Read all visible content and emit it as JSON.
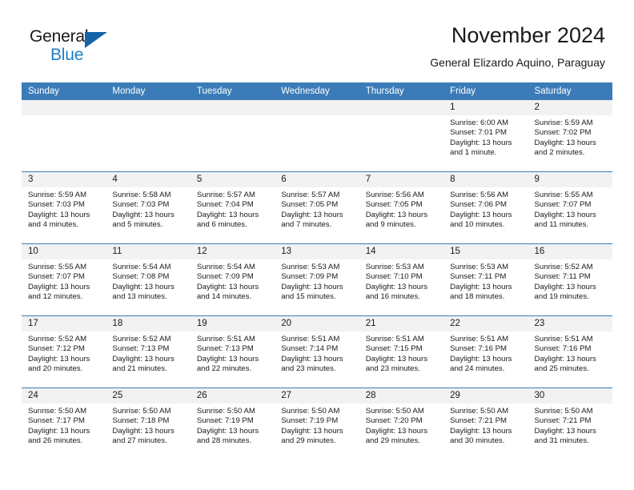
{
  "brand": {
    "word_general": "General",
    "word_blue": "Blue",
    "triangle_color": "#1565a8",
    "blue_color": "#1d80c8"
  },
  "header": {
    "title": "November 2024",
    "subtitle": "General Elizardo Aquino, Paraguay"
  },
  "theme": {
    "header_bar": "#3b7cb8",
    "day_band": "#f2f2f2",
    "text": "#1a1a1a"
  },
  "calendar": {
    "weekdays": [
      "Sunday",
      "Monday",
      "Tuesday",
      "Wednesday",
      "Thursday",
      "Friday",
      "Saturday"
    ],
    "weeks": [
      [
        {
          "day": "",
          "empty": true
        },
        {
          "day": "",
          "empty": true
        },
        {
          "day": "",
          "empty": true
        },
        {
          "day": "",
          "empty": true
        },
        {
          "day": "",
          "empty": true
        },
        {
          "day": "1",
          "sunrise": "Sunrise: 6:00 AM",
          "sunset": "Sunset: 7:01 PM",
          "daylight": "Daylight: 13 hours and 1 minute."
        },
        {
          "day": "2",
          "sunrise": "Sunrise: 5:59 AM",
          "sunset": "Sunset: 7:02 PM",
          "daylight": "Daylight: 13 hours and 2 minutes."
        }
      ],
      [
        {
          "day": "3",
          "sunrise": "Sunrise: 5:59 AM",
          "sunset": "Sunset: 7:03 PM",
          "daylight": "Daylight: 13 hours and 4 minutes."
        },
        {
          "day": "4",
          "sunrise": "Sunrise: 5:58 AM",
          "sunset": "Sunset: 7:03 PM",
          "daylight": "Daylight: 13 hours and 5 minutes."
        },
        {
          "day": "5",
          "sunrise": "Sunrise: 5:57 AM",
          "sunset": "Sunset: 7:04 PM",
          "daylight": "Daylight: 13 hours and 6 minutes."
        },
        {
          "day": "6",
          "sunrise": "Sunrise: 5:57 AM",
          "sunset": "Sunset: 7:05 PM",
          "daylight": "Daylight: 13 hours and 7 minutes."
        },
        {
          "day": "7",
          "sunrise": "Sunrise: 5:56 AM",
          "sunset": "Sunset: 7:05 PM",
          "daylight": "Daylight: 13 hours and 9 minutes."
        },
        {
          "day": "8",
          "sunrise": "Sunrise: 5:56 AM",
          "sunset": "Sunset: 7:06 PM",
          "daylight": "Daylight: 13 hours and 10 minutes."
        },
        {
          "day": "9",
          "sunrise": "Sunrise: 5:55 AM",
          "sunset": "Sunset: 7:07 PM",
          "daylight": "Daylight: 13 hours and 11 minutes."
        }
      ],
      [
        {
          "day": "10",
          "sunrise": "Sunrise: 5:55 AM",
          "sunset": "Sunset: 7:07 PM",
          "daylight": "Daylight: 13 hours and 12 minutes."
        },
        {
          "day": "11",
          "sunrise": "Sunrise: 5:54 AM",
          "sunset": "Sunset: 7:08 PM",
          "daylight": "Daylight: 13 hours and 13 minutes."
        },
        {
          "day": "12",
          "sunrise": "Sunrise: 5:54 AM",
          "sunset": "Sunset: 7:09 PM",
          "daylight": "Daylight: 13 hours and 14 minutes."
        },
        {
          "day": "13",
          "sunrise": "Sunrise: 5:53 AM",
          "sunset": "Sunset: 7:09 PM",
          "daylight": "Daylight: 13 hours and 15 minutes."
        },
        {
          "day": "14",
          "sunrise": "Sunrise: 5:53 AM",
          "sunset": "Sunset: 7:10 PM",
          "daylight": "Daylight: 13 hours and 16 minutes."
        },
        {
          "day": "15",
          "sunrise": "Sunrise: 5:53 AM",
          "sunset": "Sunset: 7:11 PM",
          "daylight": "Daylight: 13 hours and 18 minutes."
        },
        {
          "day": "16",
          "sunrise": "Sunrise: 5:52 AM",
          "sunset": "Sunset: 7:11 PM",
          "daylight": "Daylight: 13 hours and 19 minutes."
        }
      ],
      [
        {
          "day": "17",
          "sunrise": "Sunrise: 5:52 AM",
          "sunset": "Sunset: 7:12 PM",
          "daylight": "Daylight: 13 hours and 20 minutes."
        },
        {
          "day": "18",
          "sunrise": "Sunrise: 5:52 AM",
          "sunset": "Sunset: 7:13 PM",
          "daylight": "Daylight: 13 hours and 21 minutes."
        },
        {
          "day": "19",
          "sunrise": "Sunrise: 5:51 AM",
          "sunset": "Sunset: 7:13 PM",
          "daylight": "Daylight: 13 hours and 22 minutes."
        },
        {
          "day": "20",
          "sunrise": "Sunrise: 5:51 AM",
          "sunset": "Sunset: 7:14 PM",
          "daylight": "Daylight: 13 hours and 23 minutes."
        },
        {
          "day": "21",
          "sunrise": "Sunrise: 5:51 AM",
          "sunset": "Sunset: 7:15 PM",
          "daylight": "Daylight: 13 hours and 23 minutes."
        },
        {
          "day": "22",
          "sunrise": "Sunrise: 5:51 AM",
          "sunset": "Sunset: 7:16 PM",
          "daylight": "Daylight: 13 hours and 24 minutes."
        },
        {
          "day": "23",
          "sunrise": "Sunrise: 5:51 AM",
          "sunset": "Sunset: 7:16 PM",
          "daylight": "Daylight: 13 hours and 25 minutes."
        }
      ],
      [
        {
          "day": "24",
          "sunrise": "Sunrise: 5:50 AM",
          "sunset": "Sunset: 7:17 PM",
          "daylight": "Daylight: 13 hours and 26 minutes."
        },
        {
          "day": "25",
          "sunrise": "Sunrise: 5:50 AM",
          "sunset": "Sunset: 7:18 PM",
          "daylight": "Daylight: 13 hours and 27 minutes."
        },
        {
          "day": "26",
          "sunrise": "Sunrise: 5:50 AM",
          "sunset": "Sunset: 7:19 PM",
          "daylight": "Daylight: 13 hours and 28 minutes."
        },
        {
          "day": "27",
          "sunrise": "Sunrise: 5:50 AM",
          "sunset": "Sunset: 7:19 PM",
          "daylight": "Daylight: 13 hours and 29 minutes."
        },
        {
          "day": "28",
          "sunrise": "Sunrise: 5:50 AM",
          "sunset": "Sunset: 7:20 PM",
          "daylight": "Daylight: 13 hours and 29 minutes."
        },
        {
          "day": "29",
          "sunrise": "Sunrise: 5:50 AM",
          "sunset": "Sunset: 7:21 PM",
          "daylight": "Daylight: 13 hours and 30 minutes."
        },
        {
          "day": "30",
          "sunrise": "Sunrise: 5:50 AM",
          "sunset": "Sunset: 7:21 PM",
          "daylight": "Daylight: 13 hours and 31 minutes."
        }
      ]
    ]
  }
}
